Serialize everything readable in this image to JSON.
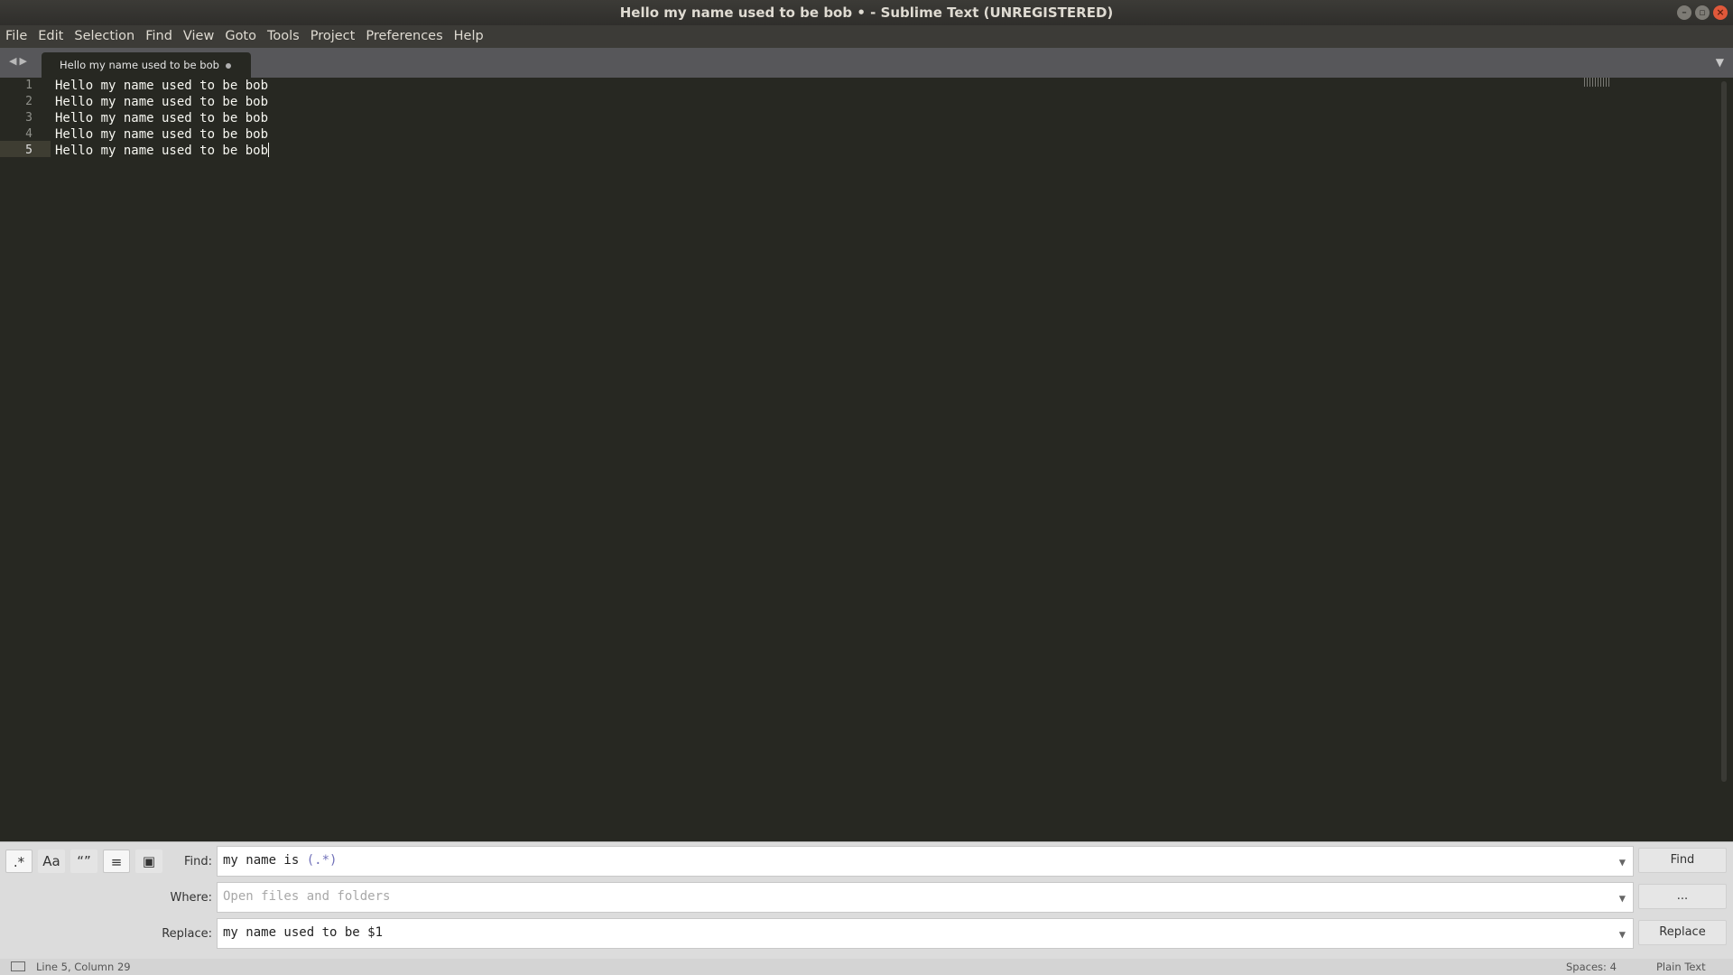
{
  "window": {
    "title": "Hello my name used to be bob • - Sublime Text (UNREGISTERED)",
    "minimize_icon": "minimize-icon",
    "maximize_icon": "maximize-icon",
    "close_icon": "close-icon"
  },
  "menu": {
    "items": [
      "File",
      "Edit",
      "Selection",
      "Find",
      "View",
      "Goto",
      "Tools",
      "Project",
      "Preferences",
      "Help"
    ]
  },
  "tabs": {
    "active": "Hello my name used to be bob",
    "nav_back": "◀",
    "nav_forward": "▶",
    "dropdown": "▼"
  },
  "editor": {
    "lines": [
      {
        "num": "1",
        "text": "Hello my name used to be bob"
      },
      {
        "num": "2",
        "text": "Hello my name used to be bob"
      },
      {
        "num": "3",
        "text": "Hello my name used to be bob"
      },
      {
        "num": "4",
        "text": "Hello my name used to be bob"
      },
      {
        "num": "5",
        "text": "Hello my name used to be bob"
      }
    ],
    "active_line": 5
  },
  "find_panel": {
    "options": [
      ".*",
      "Aa",
      "“”",
      "≡",
      "▣"
    ],
    "find_label": "Find:",
    "find_value_plain": "my name is ",
    "find_value_regex": "(.*)",
    "where_label": "Where:",
    "where_placeholder": "Open files and folders",
    "replace_label": "Replace:",
    "replace_value": "my name used to be $1",
    "find_button": "Find",
    "where_button": "...",
    "replace_button": "Replace"
  },
  "status": {
    "position": "Line 5, Column 29",
    "spaces": "Spaces: 4",
    "syntax": "Plain Text"
  }
}
